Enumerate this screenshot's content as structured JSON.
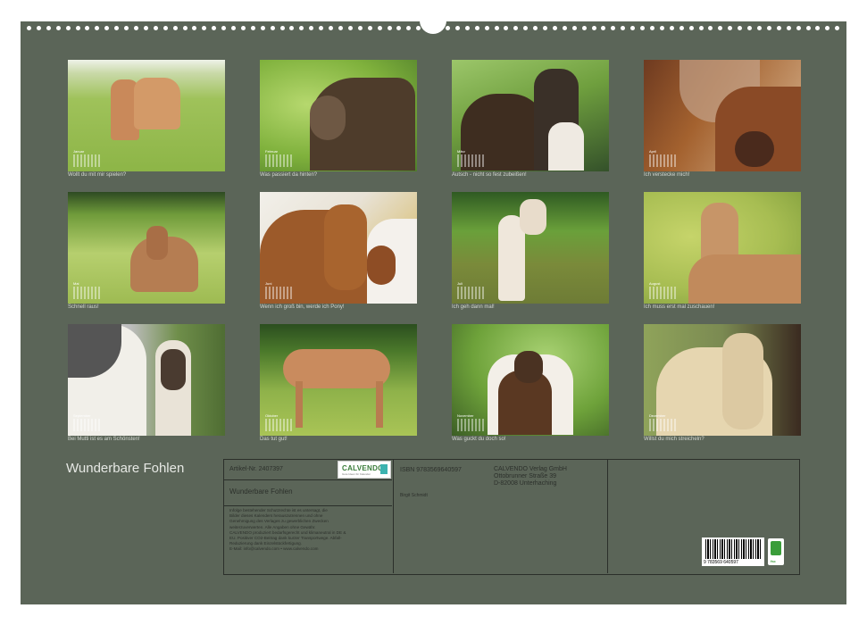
{
  "title": "Wunderbare Fohlen",
  "photos": [
    {
      "caption": "Wollt du mit mir spielen?",
      "month": "Januar"
    },
    {
      "caption": "Was passiert da hinten?",
      "month": "Februar"
    },
    {
      "caption": "Autsch - nicht so fest zubeißen!",
      "month": "März"
    },
    {
      "caption": "Ich verstecke mich!",
      "month": "April"
    },
    {
      "caption": "Schnell raus!",
      "month": "Mai"
    },
    {
      "caption": "Wenn ich groß bin, werde ich Pony!",
      "month": "Juni"
    },
    {
      "caption": "Ich geh dann mal!",
      "month": "Juli"
    },
    {
      "caption": "Ich muss erst mal zuschauen!",
      "month": "August"
    },
    {
      "caption": "Bei Mutti ist es am Schönsten!",
      "month": "September"
    },
    {
      "caption": "Das tut gut!",
      "month": "Oktober"
    },
    {
      "caption": "Was guckt du doch so!",
      "month": "November"
    },
    {
      "caption": "Willst du mich streicheln?",
      "month": "Dezember"
    }
  ],
  "info": {
    "article": "Artikel-Nr. 2407397",
    "isbn": "ISBN 9783569640597",
    "publisher": [
      "CALVENDO Verlag GmbH",
      "Ottobrunner Straße 39",
      "D-82008 Unterhaching"
    ],
    "product_title": "Wunderbare Fohlen",
    "author": "Birgit Schmidt",
    "legal": [
      "Infolge bestehender Schutzrechte ist es untersagt, die",
      "Bilder dieses Kalenders herauszutrennen und ohne",
      "Genehmigung des Verlages zu gewerblichen Zwecken",
      "weiterzuverwerten. Alle Angaben ohne Gewähr.",
      "CALVENDO produziert bedarfsgerecht und klimaneutral in DE &",
      "EU. Positiver CO2-Beitrag dank kurzer Transportwege. Abfall-",
      "Reduzierung dank Einzelstückfertigung.",
      "E-Mail: info@calvendo.com • www.calvendo.com"
    ],
    "logo_name": "CALVENDO",
    "logo_sub": "Gute Ideen für Kalender",
    "barcode_number": "9 783569 640597",
    "fsc_label": "fsc"
  }
}
